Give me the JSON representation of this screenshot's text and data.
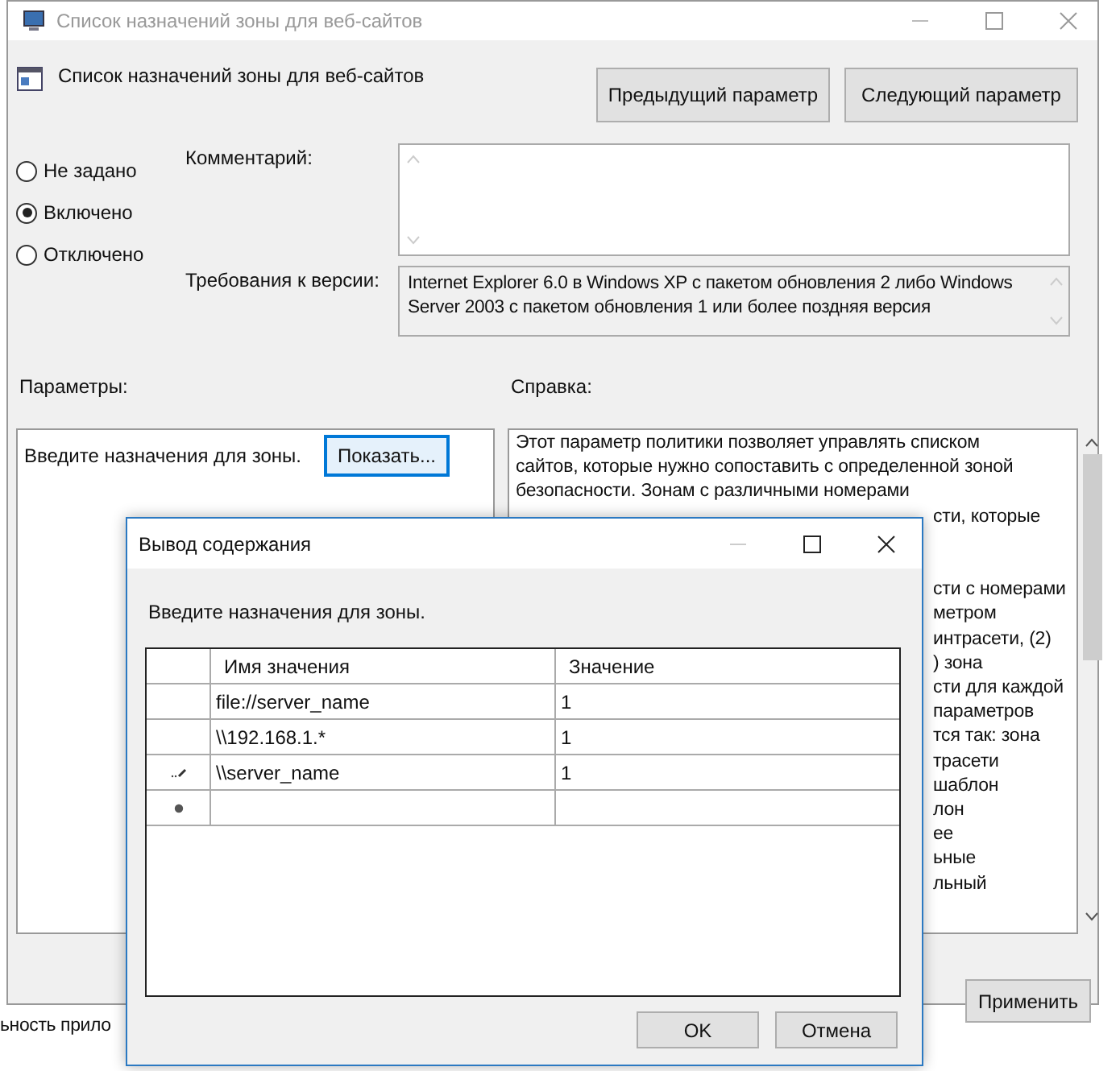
{
  "main_window": {
    "title": "Список назначений зоны для веб-сайтов"
  },
  "policy": {
    "title": "Список назначений зоны для веб-сайтов",
    "prev_button": "Предыдущий параметр",
    "next_button": "Следующий параметр"
  },
  "state_options": [
    {
      "label": "Не задано",
      "selected": false
    },
    {
      "label": "Включено",
      "selected": true
    },
    {
      "label": "Отключено",
      "selected": false
    }
  ],
  "comment": {
    "label": "Комментарий:"
  },
  "requirements": {
    "label": "Требования к версии:",
    "value": "Internet Explorer 6.0 в Windows XP с пакетом обновления 2 либо Windows Server 2003 с пакетом обновления 1 или более поздняя версия"
  },
  "options_panel": {
    "heading": "Параметры:",
    "prompt": "Введите назначения для зоны.",
    "show_button": "Показать..."
  },
  "help_panel": {
    "heading": "Справка:",
    "lines": [
      "Этот параметр политики позволяет управлять списком",
      "сайтов, которые нужно сопоставить с определенной зоной",
      "безопасности. Зонам с различными номерами"
    ],
    "fragments": [
      "сти, которые",
      "сти с номерами",
      "метром",
      "интрасети, (2)",
      ") зона",
      "сти для каждой",
      "параметров",
      "тся так: зона",
      "трасети",
      "шаблон",
      "лон",
      "ее",
      "ьные",
      "льный"
    ]
  },
  "footer_buttons": [
    "Применить"
  ],
  "background_fragment": "ьность прило",
  "dialog": {
    "title": "Вывод содержания",
    "prompt": "Введите назначения для зоны.",
    "columns": [
      "Имя значения",
      "Значение"
    ],
    "rows": [
      {
        "kind": "plain",
        "name": "file://server_name",
        "value": "1"
      },
      {
        "kind": "plain",
        "name": "\\\\192.168.1.*",
        "value": "1"
      },
      {
        "kind": "editing",
        "name": "\\\\server_name",
        "value": "1"
      },
      {
        "kind": "new"
      }
    ],
    "buttons": [
      "OK",
      "Отмена"
    ]
  }
}
